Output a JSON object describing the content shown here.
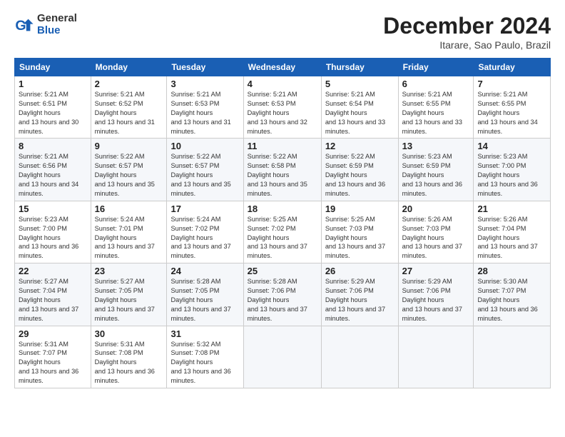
{
  "header": {
    "logo": {
      "general": "General",
      "blue": "Blue"
    },
    "title": "December 2024",
    "subtitle": "Itarare, Sao Paulo, Brazil"
  },
  "weekdays": [
    "Sunday",
    "Monday",
    "Tuesday",
    "Wednesday",
    "Thursday",
    "Friday",
    "Saturday"
  ],
  "weeks": [
    [
      {
        "day": 1,
        "sunrise": "5:21 AM",
        "sunset": "6:51 PM",
        "daylight": "13 hours and 30 minutes."
      },
      {
        "day": 2,
        "sunrise": "5:21 AM",
        "sunset": "6:52 PM",
        "daylight": "13 hours and 31 minutes."
      },
      {
        "day": 3,
        "sunrise": "5:21 AM",
        "sunset": "6:53 PM",
        "daylight": "13 hours and 31 minutes."
      },
      {
        "day": 4,
        "sunrise": "5:21 AM",
        "sunset": "6:53 PM",
        "daylight": "13 hours and 32 minutes."
      },
      {
        "day": 5,
        "sunrise": "5:21 AM",
        "sunset": "6:54 PM",
        "daylight": "13 hours and 33 minutes."
      },
      {
        "day": 6,
        "sunrise": "5:21 AM",
        "sunset": "6:55 PM",
        "daylight": "13 hours and 33 minutes."
      },
      {
        "day": 7,
        "sunrise": "5:21 AM",
        "sunset": "6:55 PM",
        "daylight": "13 hours and 34 minutes."
      }
    ],
    [
      {
        "day": 8,
        "sunrise": "5:21 AM",
        "sunset": "6:56 PM",
        "daylight": "13 hours and 34 minutes."
      },
      {
        "day": 9,
        "sunrise": "5:22 AM",
        "sunset": "6:57 PM",
        "daylight": "13 hours and 35 minutes."
      },
      {
        "day": 10,
        "sunrise": "5:22 AM",
        "sunset": "6:57 PM",
        "daylight": "13 hours and 35 minutes."
      },
      {
        "day": 11,
        "sunrise": "5:22 AM",
        "sunset": "6:58 PM",
        "daylight": "13 hours and 35 minutes."
      },
      {
        "day": 12,
        "sunrise": "5:22 AM",
        "sunset": "6:59 PM",
        "daylight": "13 hours and 36 minutes."
      },
      {
        "day": 13,
        "sunrise": "5:23 AM",
        "sunset": "6:59 PM",
        "daylight": "13 hours and 36 minutes."
      },
      {
        "day": 14,
        "sunrise": "5:23 AM",
        "sunset": "7:00 PM",
        "daylight": "13 hours and 36 minutes."
      }
    ],
    [
      {
        "day": 15,
        "sunrise": "5:23 AM",
        "sunset": "7:00 PM",
        "daylight": "13 hours and 36 minutes."
      },
      {
        "day": 16,
        "sunrise": "5:24 AM",
        "sunset": "7:01 PM",
        "daylight": "13 hours and 37 minutes."
      },
      {
        "day": 17,
        "sunrise": "5:24 AM",
        "sunset": "7:02 PM",
        "daylight": "13 hours and 37 minutes."
      },
      {
        "day": 18,
        "sunrise": "5:25 AM",
        "sunset": "7:02 PM",
        "daylight": "13 hours and 37 minutes."
      },
      {
        "day": 19,
        "sunrise": "5:25 AM",
        "sunset": "7:03 PM",
        "daylight": "13 hours and 37 minutes."
      },
      {
        "day": 20,
        "sunrise": "5:26 AM",
        "sunset": "7:03 PM",
        "daylight": "13 hours and 37 minutes."
      },
      {
        "day": 21,
        "sunrise": "5:26 AM",
        "sunset": "7:04 PM",
        "daylight": "13 hours and 37 minutes."
      }
    ],
    [
      {
        "day": 22,
        "sunrise": "5:27 AM",
        "sunset": "7:04 PM",
        "daylight": "13 hours and 37 minutes."
      },
      {
        "day": 23,
        "sunrise": "5:27 AM",
        "sunset": "7:05 PM",
        "daylight": "13 hours and 37 minutes."
      },
      {
        "day": 24,
        "sunrise": "5:28 AM",
        "sunset": "7:05 PM",
        "daylight": "13 hours and 37 minutes."
      },
      {
        "day": 25,
        "sunrise": "5:28 AM",
        "sunset": "7:06 PM",
        "daylight": "13 hours and 37 minutes."
      },
      {
        "day": 26,
        "sunrise": "5:29 AM",
        "sunset": "7:06 PM",
        "daylight": "13 hours and 37 minutes."
      },
      {
        "day": 27,
        "sunrise": "5:29 AM",
        "sunset": "7:06 PM",
        "daylight": "13 hours and 37 minutes."
      },
      {
        "day": 28,
        "sunrise": "5:30 AM",
        "sunset": "7:07 PM",
        "daylight": "13 hours and 36 minutes."
      }
    ],
    [
      {
        "day": 29,
        "sunrise": "5:31 AM",
        "sunset": "7:07 PM",
        "daylight": "13 hours and 36 minutes."
      },
      {
        "day": 30,
        "sunrise": "5:31 AM",
        "sunset": "7:08 PM",
        "daylight": "13 hours and 36 minutes."
      },
      {
        "day": 31,
        "sunrise": "5:32 AM",
        "sunset": "7:08 PM",
        "daylight": "13 hours and 36 minutes."
      },
      null,
      null,
      null,
      null
    ]
  ]
}
